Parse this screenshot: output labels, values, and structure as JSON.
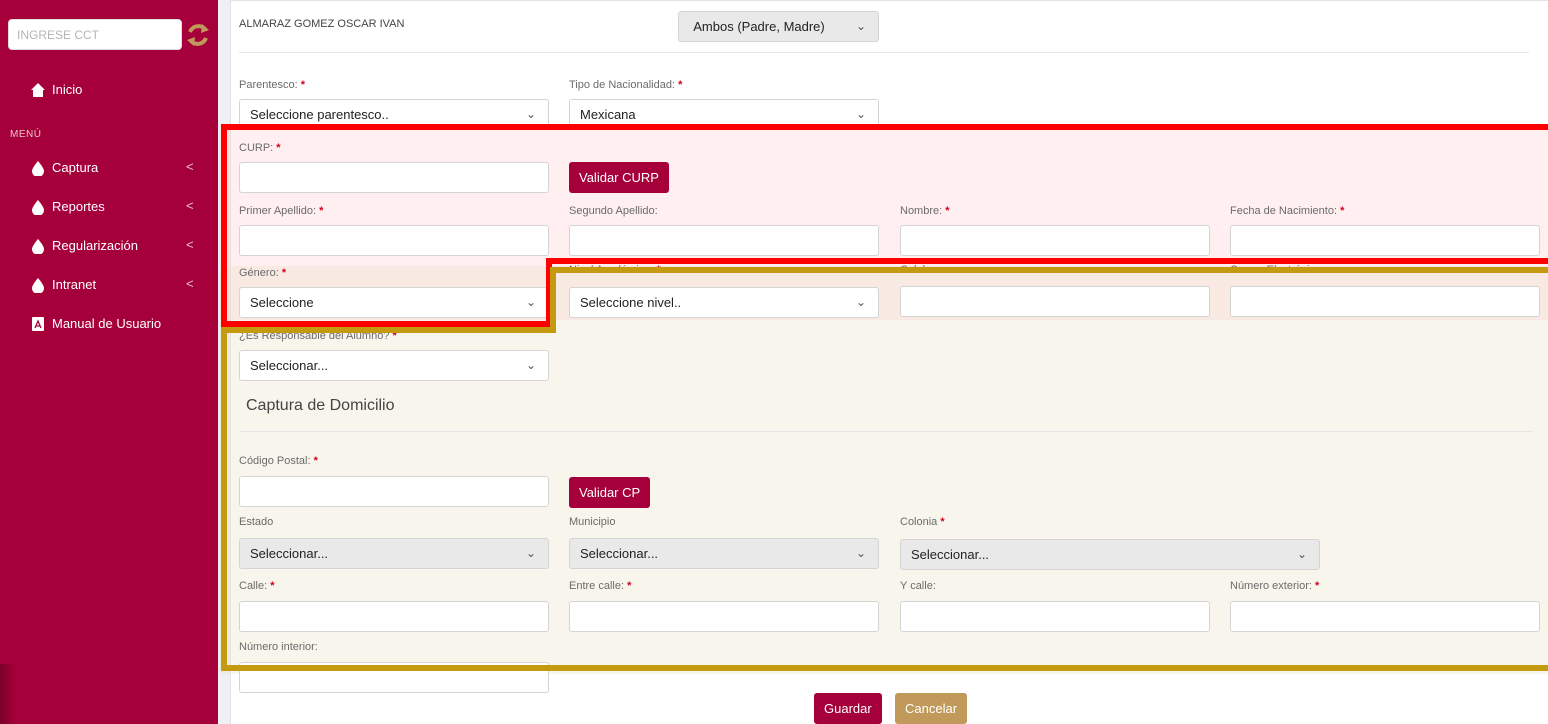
{
  "sidebar": {
    "cct_placeholder": "INGRESE CCT",
    "menu_header": "MENÚ",
    "items": [
      {
        "label": "Inicio",
        "icon": "home-icon"
      },
      {
        "label": "Captura",
        "icon": "drop-icon"
      },
      {
        "label": "Reportes",
        "icon": "drop-icon"
      },
      {
        "label": "Regularización",
        "icon": "drop-icon"
      },
      {
        "label": "Intranet",
        "icon": "drop-icon"
      },
      {
        "label": "Manual de Usuario",
        "icon": "pdf-icon"
      }
    ],
    "chevron": "<"
  },
  "form": {
    "student_name": "ALMARAZ GOMEZ OSCAR IVAN",
    "tutor_type": "Ambos (Padre, Madre)",
    "required_mark": "*",
    "parentesco_label": "Parentesco:",
    "parentesco_value": "Seleccione parentesco..",
    "nacionalidad_label": "Tipo de Nacionalidad:",
    "nacionalidad_value": "Mexicana",
    "curp_label": "CURP:",
    "validar_curp": "Validar CURP",
    "primer_apellido_label": "Primer Apellido:",
    "segundo_apellido_label": "Segundo Apellido:",
    "nombre_label": "Nombre:",
    "fecha_nac_label": "Fecha de Nacimiento:",
    "genero_label": "Género:",
    "genero_value": "Seleccione",
    "nivel_label": "Nivel Académico:",
    "nivel_value": "Seleccione nivel..",
    "celular_label": "Celular:",
    "correo_label": "Correo Electrónico:",
    "responsable_label": "¿Es Responsable del Alumno?",
    "responsable_value": "Seleccionar...",
    "domicilio_title": "Captura de Domicilio",
    "cp_label": "Código Postal:",
    "validar_cp": "Validar CP",
    "estado_label": "Estado",
    "estado_value": "Seleccionar...",
    "municipio_label": "Municipio",
    "municipio_value": "Seleccionar...",
    "colonia_label": "Colonia",
    "colonia_value": "Seleccionar...",
    "calle_label": "Calle:",
    "entre_calle_label": "Entre calle:",
    "y_calle_label": "Y calle:",
    "num_ext_label": "Número exterior:",
    "num_int_label": "Número interior:",
    "guardar": "Guardar",
    "cancelar": "Cancelar"
  },
  "colors": {
    "brand": "#a6003a",
    "gold": "#c19a5b",
    "highlight_red": "#ff0000",
    "highlight_gold": "#c49a10"
  }
}
